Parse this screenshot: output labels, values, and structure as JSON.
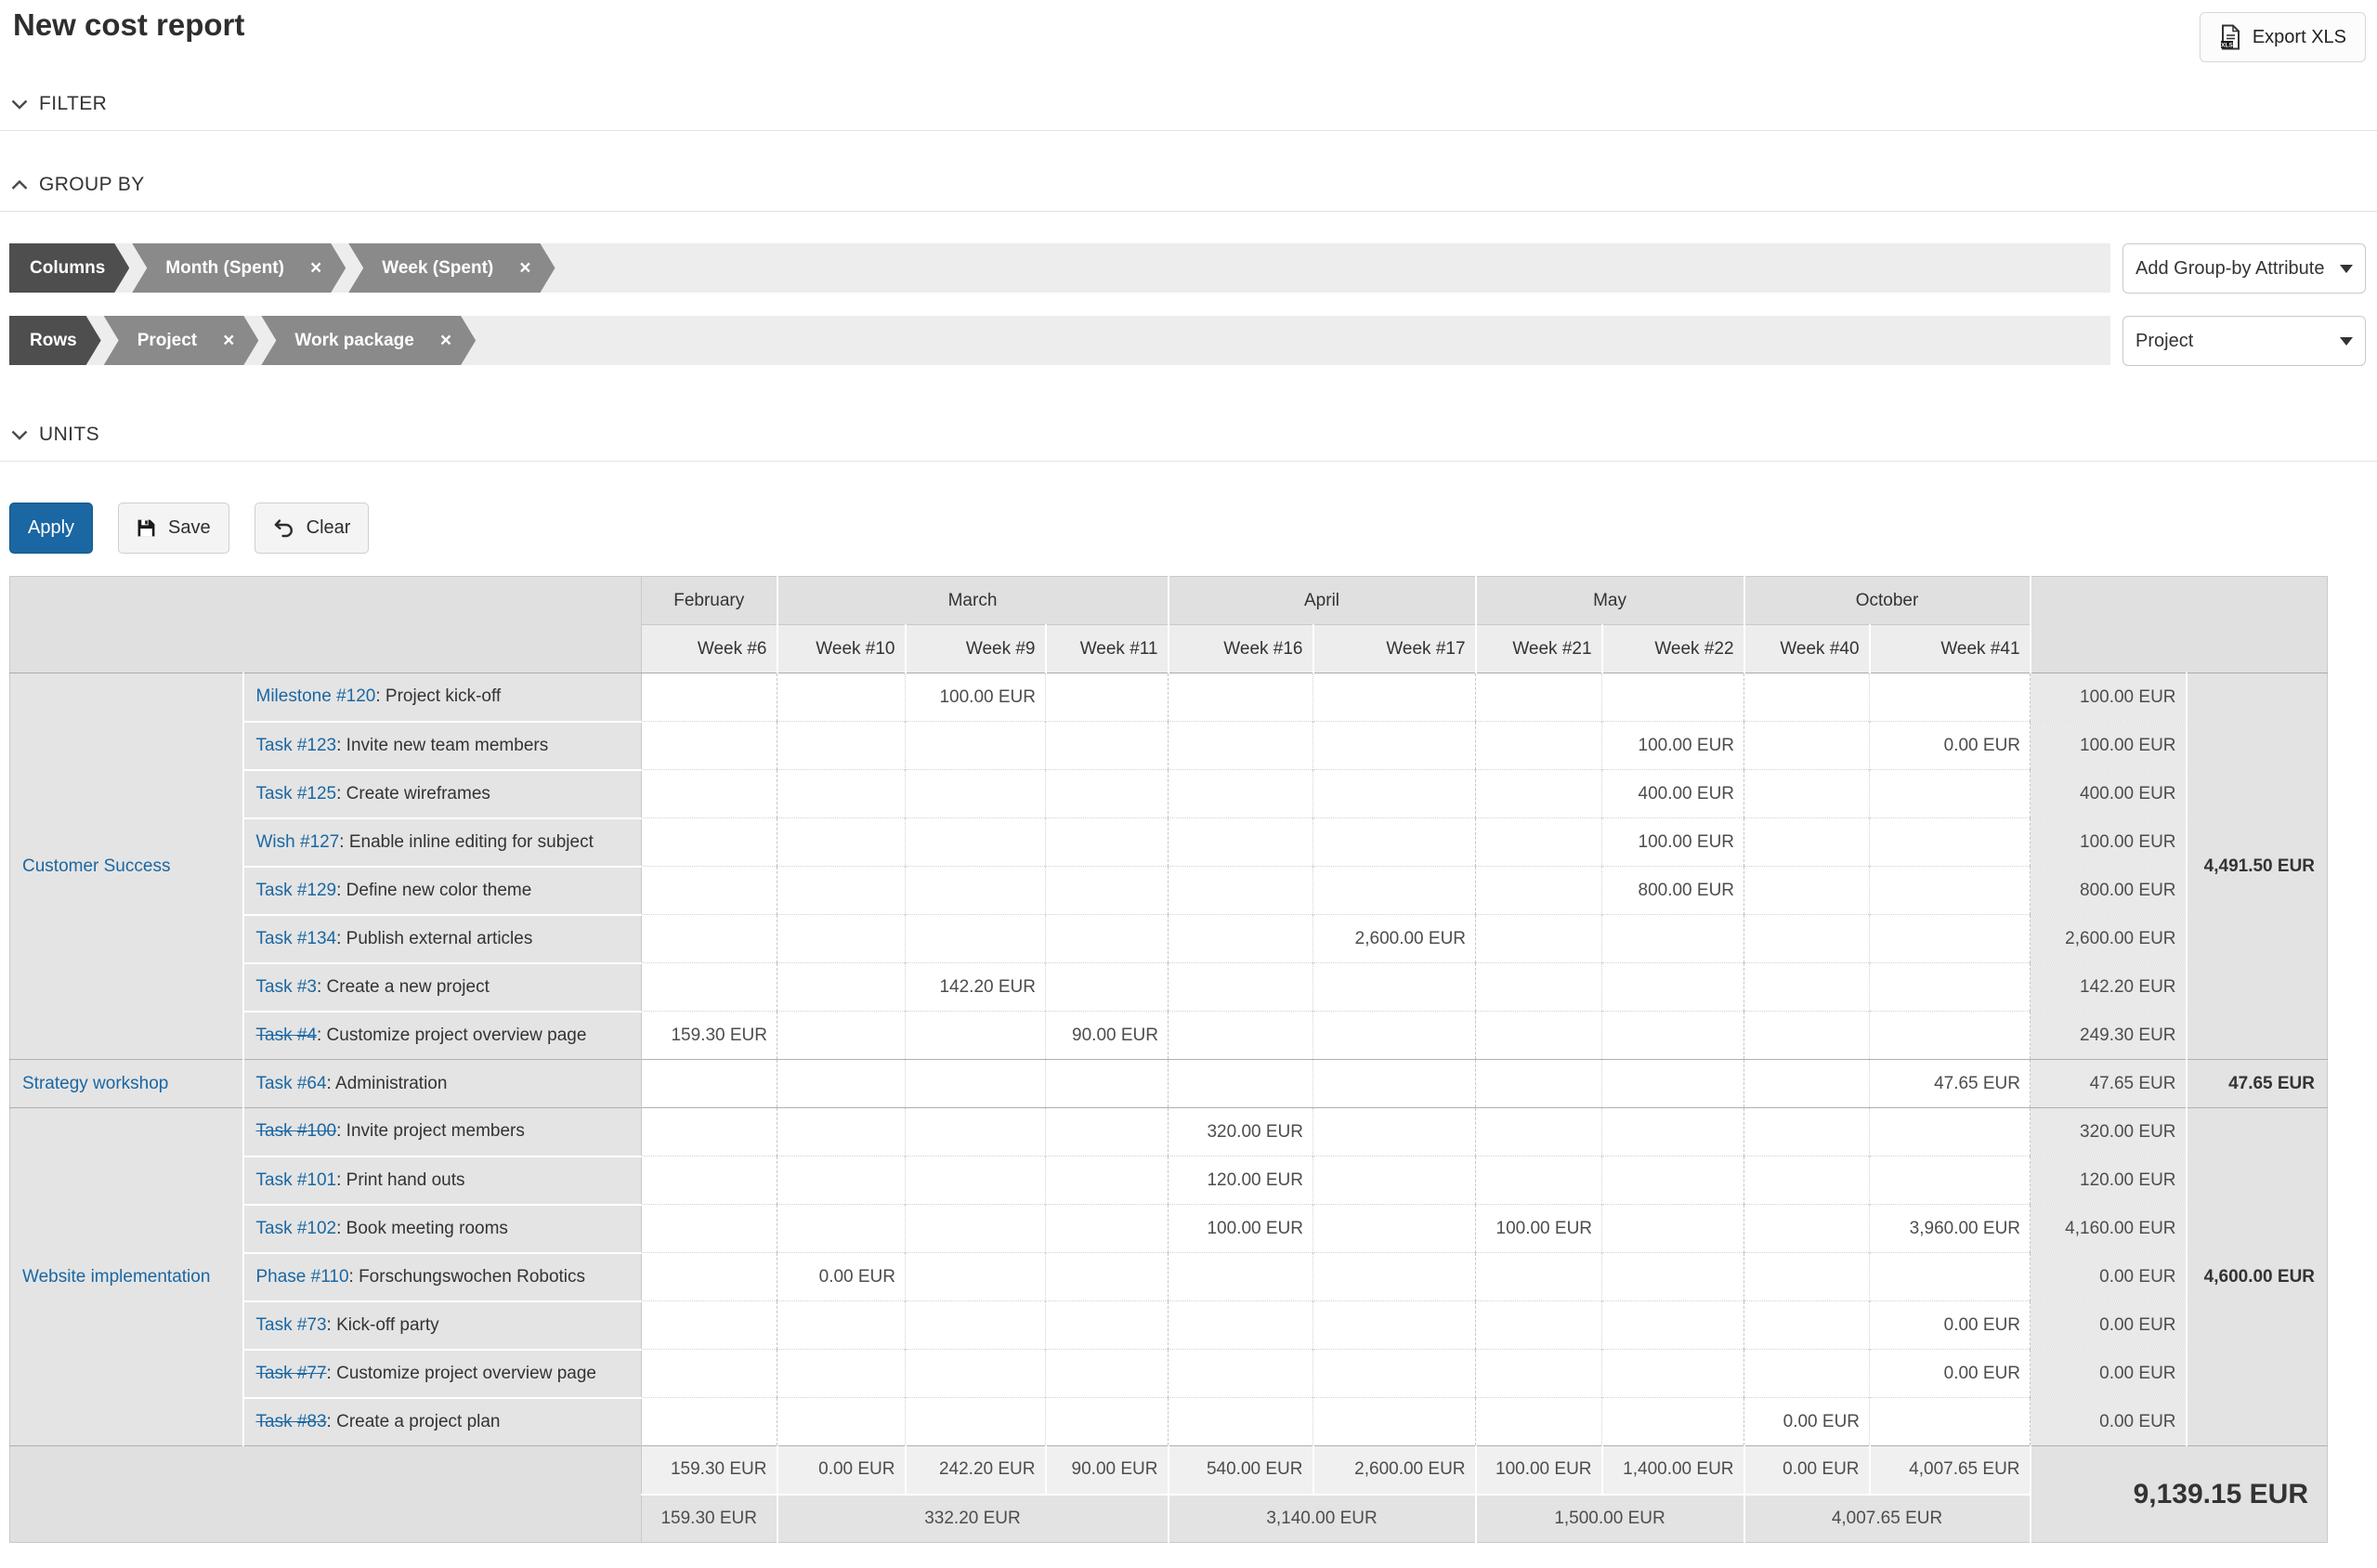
{
  "page": {
    "title": "New cost report"
  },
  "toolbar": {
    "export_label": "Export XLS"
  },
  "sections": {
    "filter": "FILTER",
    "group_by": "GROUP BY",
    "units": "UNITS"
  },
  "group_by": {
    "columns_label": "Columns",
    "columns_chips": [
      "Month (Spent)",
      "Week (Spent)"
    ],
    "rows_label": "Rows",
    "rows_chips": [
      "Project",
      "Work package"
    ],
    "add_attribute_dropdown": "Add Group-by Attribute",
    "project_dropdown": "Project",
    "remove_icon": "×"
  },
  "actions": {
    "apply": "Apply",
    "save": "Save",
    "clear": "Clear"
  },
  "colors": {
    "accent": "#1a67a3",
    "link": "#1a67a3",
    "chip_head": "#4e4e4e",
    "chip": "#8a8a8a"
  },
  "icons": {
    "export": "spreadsheet-xls-document",
    "filter_state": "chevron-down",
    "group_by_state": "chevron-up",
    "units_state": "chevron-down",
    "save": "floppy-disk",
    "clear": "undo-arrow",
    "dropdown": "caret-down",
    "chip_remove": "close-x"
  },
  "table": {
    "months": [
      {
        "label": "February",
        "weeks": 1
      },
      {
        "label": "March",
        "weeks": 3
      },
      {
        "label": "April",
        "weeks": 2
      },
      {
        "label": "May",
        "weeks": 2
      },
      {
        "label": "October",
        "weeks": 2
      }
    ],
    "weeks": [
      "Week #6",
      "Week #10",
      "Week #9",
      "Week #11",
      "Week #16",
      "Week #17",
      "Week #21",
      "Week #22",
      "Week #40",
      "Week #41"
    ],
    "groups": [
      {
        "project": "Customer Success",
        "total": "4,491.50 EUR",
        "rows": [
          {
            "id": "Milestone #120",
            "struck": false,
            "desc": ": Project kick-off",
            "cells": [
              "",
              "",
              "100.00 EUR",
              "",
              "",
              "",
              "",
              "",
              "",
              ""
            ],
            "sum": "100.00 EUR"
          },
          {
            "id": "Task #123",
            "struck": false,
            "desc": ": Invite new team members",
            "cells": [
              "",
              "",
              "",
              "",
              "",
              "",
              "",
              "100.00 EUR",
              "",
              "0.00 EUR"
            ],
            "sum": "100.00 EUR"
          },
          {
            "id": "Task #125",
            "struck": false,
            "desc": ": Create wireframes",
            "cells": [
              "",
              "",
              "",
              "",
              "",
              "",
              "",
              "400.00 EUR",
              "",
              ""
            ],
            "sum": "400.00 EUR"
          },
          {
            "id": "Wish #127",
            "struck": false,
            "desc": ": Enable inline editing for subject",
            "cells": [
              "",
              "",
              "",
              "",
              "",
              "",
              "",
              "100.00 EUR",
              "",
              ""
            ],
            "sum": "100.00 EUR"
          },
          {
            "id": "Task #129",
            "struck": false,
            "desc": ": Define new color theme",
            "cells": [
              "",
              "",
              "",
              "",
              "",
              "",
              "",
              "800.00 EUR",
              "",
              ""
            ],
            "sum": "800.00 EUR"
          },
          {
            "id": "Task #134",
            "struck": false,
            "desc": ": Publish external articles",
            "cells": [
              "",
              "",
              "",
              "",
              "",
              "2,600.00 EUR",
              "",
              "",
              "",
              ""
            ],
            "sum": "2,600.00 EUR"
          },
          {
            "id": "Task #3",
            "struck": false,
            "desc": ": Create a new project",
            "cells": [
              "",
              "",
              "142.20 EUR",
              "",
              "",
              "",
              "",
              "",
              "",
              ""
            ],
            "sum": "142.20 EUR"
          },
          {
            "id": "Task #4",
            "struck": true,
            "desc": ": Customize project overview page",
            "cells": [
              "159.30 EUR",
              "",
              "",
              "90.00 EUR",
              "",
              "",
              "",
              "",
              "",
              ""
            ],
            "sum": "249.30 EUR"
          }
        ]
      },
      {
        "project": "Strategy workshop",
        "total": "47.65 EUR",
        "rows": [
          {
            "id": "Task #64",
            "struck": false,
            "desc": ": Administration",
            "cells": [
              "",
              "",
              "",
              "",
              "",
              "",
              "",
              "",
              "",
              "47.65 EUR"
            ],
            "sum": "47.65 EUR"
          }
        ]
      },
      {
        "project": "Website implementation",
        "total": "4,600.00 EUR",
        "rows": [
          {
            "id": "Task #100",
            "struck": true,
            "desc": ": Invite project members",
            "cells": [
              "",
              "",
              "",
              "",
              "320.00 EUR",
              "",
              "",
              "",
              "",
              ""
            ],
            "sum": "320.00 EUR"
          },
          {
            "id": "Task #101",
            "struck": false,
            "desc": ": Print hand outs",
            "cells": [
              "",
              "",
              "",
              "",
              "120.00 EUR",
              "",
              "",
              "",
              "",
              ""
            ],
            "sum": "120.00 EUR"
          },
          {
            "id": "Task #102",
            "struck": false,
            "desc": ": Book meeting rooms",
            "cells": [
              "",
              "",
              "",
              "",
              "100.00 EUR",
              "",
              "100.00 EUR",
              "",
              "",
              "3,960.00 EUR"
            ],
            "sum": "4,160.00 EUR"
          },
          {
            "id": "Phase #110",
            "struck": false,
            "desc": ": Forschungswochen Robotics",
            "cells": [
              "",
              "0.00 EUR",
              "",
              "",
              "",
              "",
              "",
              "",
              "",
              ""
            ],
            "sum": "0.00 EUR"
          },
          {
            "id": "Task #73",
            "struck": false,
            "desc": ": Kick-off party",
            "cells": [
              "",
              "",
              "",
              "",
              "",
              "",
              "",
              "",
              "",
              "0.00 EUR"
            ],
            "sum": "0.00 EUR"
          },
          {
            "id": "Task #77",
            "struck": true,
            "desc": ": Customize project overview page",
            "cells": [
              "",
              "",
              "",
              "",
              "",
              "",
              "",
              "",
              "",
              "0.00 EUR"
            ],
            "sum": "0.00 EUR"
          },
          {
            "id": "Task #83",
            "struck": true,
            "desc": ": Create a project plan",
            "cells": [
              "",
              "",
              "",
              "",
              "",
              "",
              "",
              "",
              "0.00 EUR",
              ""
            ],
            "sum": "0.00 EUR"
          }
        ]
      }
    ],
    "footer": {
      "week_totals": [
        "159.30 EUR",
        "0.00 EUR",
        "242.20 EUR",
        "90.00 EUR",
        "540.00 EUR",
        "2,600.00 EUR",
        "100.00 EUR",
        "1,400.00 EUR",
        "0.00 EUR",
        "4,007.65 EUR"
      ],
      "month_totals": [
        "159.30 EUR",
        "332.20 EUR",
        "3,140.00 EUR",
        "1,500.00 EUR",
        "4,007.65 EUR"
      ],
      "grand_total": "9,139.15 EUR"
    }
  }
}
